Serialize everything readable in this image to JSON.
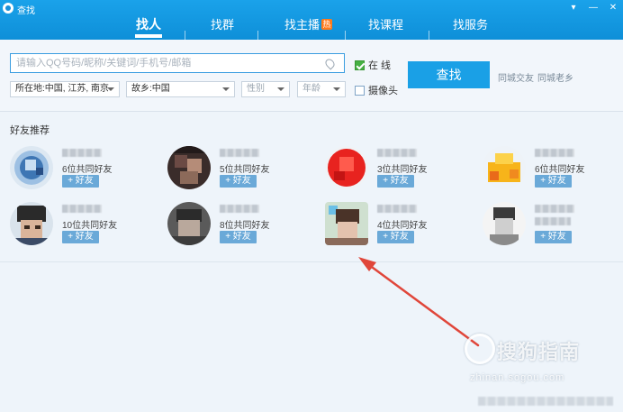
{
  "window": {
    "title": "查找"
  },
  "tabs": [
    {
      "label": "找人"
    },
    {
      "label": "找群"
    },
    {
      "label": "找主播",
      "badge": "热"
    },
    {
      "label": "找课程"
    },
    {
      "label": "找服务"
    }
  ],
  "search": {
    "placeholder": "请输入QQ号码/昵称/关键词/手机号/邮箱",
    "online_label": "在  线",
    "online_checked": true,
    "camera_label": "摄像头",
    "camera_checked": false,
    "button_label": "查找",
    "links": [
      "同城交友",
      "同城老乡"
    ],
    "filters": {
      "location": "所在地:中国, 江苏, 南京",
      "hometown": "故乡:中国",
      "gender": "性别",
      "age": "年龄"
    }
  },
  "recommend": {
    "title": "好友推荐",
    "add_label": "+ 好友",
    "friends": [
      {
        "mutual": "6位共同好友"
      },
      {
        "mutual": "5位共同好友"
      },
      {
        "mutual": "3位共同好友"
      },
      {
        "mutual": "6位共同好友"
      },
      {
        "mutual": "10位共同好友"
      },
      {
        "mutual": "8位共同好友"
      },
      {
        "mutual": "4位共同好友"
      },
      {
        "mutual": ""
      }
    ]
  },
  "watermark": {
    "brand": "搜狗指南",
    "url": "zhinan.sogou.com"
  },
  "colors": {
    "accent": "#1aa0e6",
    "header": "#0e8fd8",
    "annotation": "#e0463a",
    "add_button": "#6aa9d8"
  }
}
